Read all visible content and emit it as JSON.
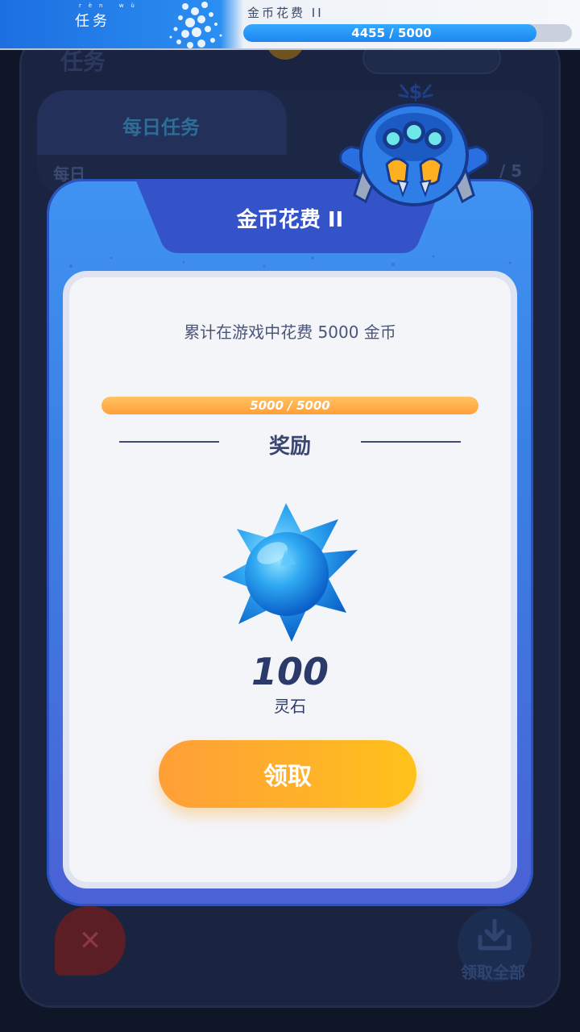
{
  "topbar": {
    "title": "任务",
    "title_ruby": "rèn wù",
    "quest_name": "金币花费 II",
    "progress_text": "4455 / 5000",
    "progress_value": 0.891
  },
  "background": {
    "panel_title": "任务",
    "daily_tab": "每日任务",
    "row_label": "每日",
    "row_count": "/ 5",
    "claim_all_label": "领取全部"
  },
  "modal": {
    "title": "金币花费 II",
    "description": "累计在游戏中花费 5000 金币",
    "progress_text": "5000 / 5000",
    "progress_value": 1.0,
    "reward_heading": "奖励",
    "reward_amount": "100",
    "reward_name": "灵石",
    "claim_label": "领取"
  },
  "icons": {
    "gem": "blue-spiked-gem-icon",
    "mascot": "blue-spider-robot-icon",
    "close": "close-icon",
    "download": "download-icon"
  },
  "colors": {
    "accent_blue": "#3a7fe6",
    "claim_orange": "#ffb328",
    "progress_orange": "#ff9f3a",
    "text_navy": "#2b3a6b"
  }
}
